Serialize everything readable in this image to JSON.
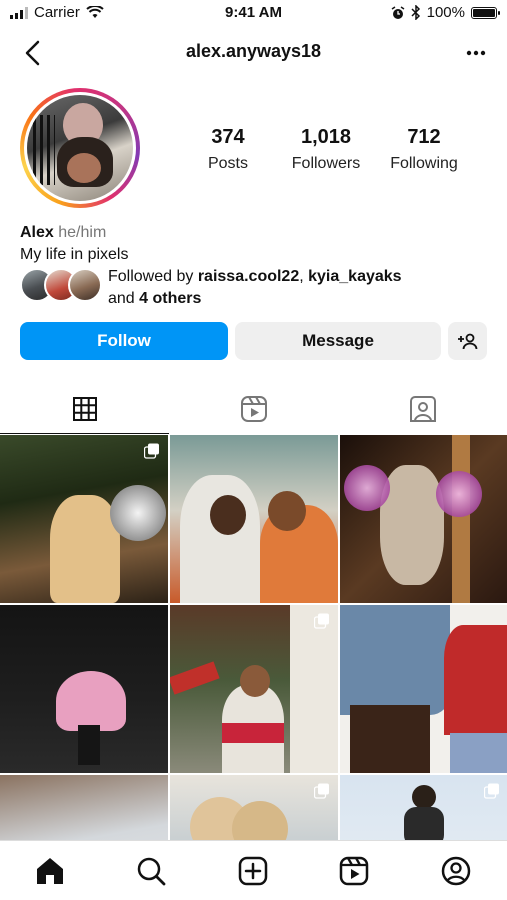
{
  "status_bar": {
    "carrier": "Carrier",
    "time": "9:41 AM",
    "battery": "100%",
    "battery_level": 1.0
  },
  "header": {
    "username": "alex.anyways18"
  },
  "stats": {
    "posts": {
      "value": "374",
      "label": "Posts"
    },
    "followers": {
      "value": "1,018",
      "label": "Followers"
    },
    "following": {
      "value": "712",
      "label": "Following"
    }
  },
  "bio": {
    "name": "Alex",
    "pronouns": "he/him",
    "text": "My life in pixels"
  },
  "followed_by": {
    "prefix": "Followed by ",
    "user1": "raissa.cool22",
    "separator": ", ",
    "user2": "kyia_kayaks",
    "and": "and ",
    "others": "4 others"
  },
  "actions": {
    "follow": "Follow",
    "message": "Message"
  },
  "colors": {
    "accent": "#0095f6",
    "secondary_button": "#efefef"
  },
  "tabs": [
    "grid-icon",
    "reels-icon",
    "tagged-icon"
  ],
  "bottom_nav": [
    "home-icon",
    "search-icon",
    "create-icon",
    "reels-icon",
    "profile-icon"
  ]
}
